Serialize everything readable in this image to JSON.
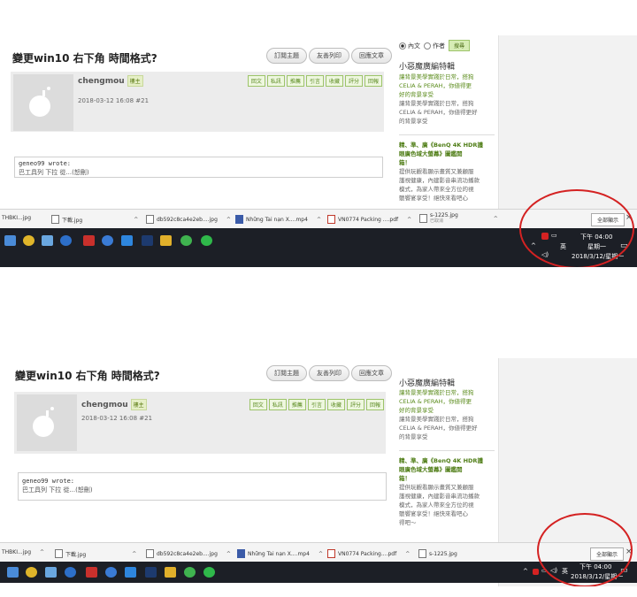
{
  "thread": {
    "title": "變更win10 右下角 時間格式?",
    "buttons": [
      "訂閱主題",
      "友善列印",
      "回應文章"
    ]
  },
  "post": {
    "author": "chengmou",
    "role_badge": "樓主",
    "time_top": "2018-03-12 16:08  #21",
    "time_bottom": "2018-03-12 16:08  #21",
    "actions": [
      "回文",
      "私訊",
      "推薦",
      "引言",
      "收藏",
      "評分",
      "回報"
    ]
  },
  "quote": {
    "author": "geneo99 wrote:",
    "text_top": "巴工具列 下拉 從...(恕刪)",
    "text_bottom": "巴工具列 下拉 從...(恕刪)"
  },
  "sidebar": {
    "search_options": [
      "內文",
      "作者"
    ],
    "search_button": "搜尋",
    "section_title": "小惡魔廣編特輯",
    "item1_lines": [
      "讓背景美學實踐於日常，搭狗",
      "CELIA & PERAH，你値得更",
      "好的背景享受"
    ],
    "item1_sub_lines": [
      "讓背景美學實踐於日常，搭狗",
      "CELIA & PERAH，你値得更好",
      "的背景享受"
    ],
    "item2_lines": [
      "精、準、廣《BenQ 4K HDR護",
      "眼廣色域大螢幕》圖鑑開",
      "箱！"
    ],
    "item2_sub_top": [
      "提供玩觀看顯示畫質又兼顧服",
      "護視健康，內建影音串流功播款",
      "模式，為家人帶來全方位的視",
      "聽饗宴享受！絕快來看吧心"
    ],
    "item2_sub_bottom": [
      "提供玩觀看顯示畫質又兼顧服",
      "護視健康，內建影音串流功播款",
      "模式，為家人帶來全方位的視",
      "聽饗宴享受！絕快來看吧心",
      "得吧～"
    ]
  },
  "downloads_top": [
    {
      "name": "THBKI...jpg",
      "icon": "file-icon"
    },
    {
      "name": "下載.jpg",
      "icon": "file-icon"
    },
    {
      "name": "db592c8ca4e2eb....jpg",
      "icon": "file-icon"
    },
    {
      "name": "Những Tai nạn X....mp4",
      "icon": "video-icon"
    },
    {
      "name": "VN0774 Packing ....pdf",
      "icon": "pdf-icon"
    },
    {
      "name": "s-1225.jpg",
      "sub": "已取消",
      "icon": "file-icon"
    }
  ],
  "downloads_bottom": [
    {
      "name": "THBKI...jpg",
      "icon": "file-icon"
    },
    {
      "name": "下載.jpg",
      "icon": "file-icon"
    },
    {
      "name": "db592c8ca4e2eb....jpg",
      "icon": "file-icon"
    },
    {
      "name": "Những Tai nạn X....mp4",
      "icon": "video-icon"
    },
    {
      "name": "VN0774 Packing....pdf",
      "icon": "pdf-icon"
    },
    {
      "name": "s-1225.jpg",
      "icon": "file-icon"
    }
  ],
  "show_all": "全部顯示",
  "close_glyph": "×",
  "tray_top": {
    "time": "下午 04:00",
    "date": "2018/3/12/星期一",
    "ime": "英"
  },
  "tray_bottom": {
    "time": "下午 04:00",
    "date": "2018/3/12/星期一",
    "ime": "英"
  },
  "colors": {
    "accent_green": "#5b8c1c",
    "taskbar": "#1c1f26",
    "annotation_red": "#d42222"
  }
}
